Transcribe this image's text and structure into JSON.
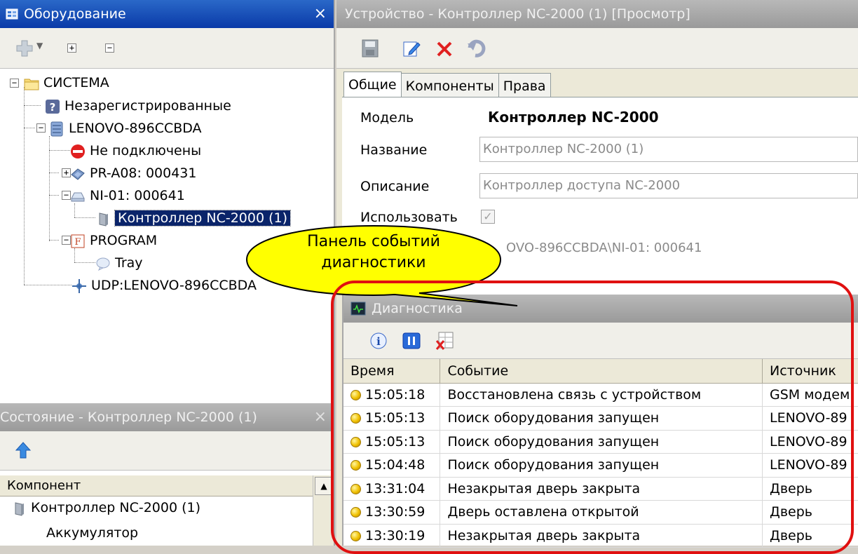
{
  "equipment_panel": {
    "title": "Оборудование",
    "close": "×",
    "tree": {
      "system": "СИСТЕМА",
      "unregistered": "Незарегистрированные",
      "host": "LENOVO-896CCBDA",
      "not_connected": "Не подключены",
      "pr_a08": "PR-A08: 000431",
      "ni_01": "NI-01: 000641",
      "controller": "Контроллер NC-2000 (1)",
      "program": "PROGRAM",
      "tray": "Tray",
      "udp": "UDP:LENOVO-896CCBDA"
    }
  },
  "state_panel": {
    "title": "Состояние - Контроллер NC-2000 (1)",
    "close": "×",
    "column_header": "Компонент",
    "rows": [
      "Контроллер NC-2000 (1)",
      "Аккумулятор"
    ]
  },
  "device_panel": {
    "title": "Устройство - Контроллер NC-2000 (1) [Просмотр]",
    "tabs": [
      "Общие",
      "Компоненты",
      "Права"
    ],
    "model_label": "Модель",
    "model_value": "Контроллер NC-2000",
    "name_label": "Название",
    "name_value": "Контроллер NC-2000 (1)",
    "desc_label": "Описание",
    "desc_value": "Контроллер доступа NC-2000",
    "use_label": "Использовать",
    "path_value": "OVO-896CCBDA\\NI-01: 000641"
  },
  "callout": {
    "line1": "Панель событий",
    "line2": "диагностики"
  },
  "diagnostics": {
    "title": "Диагностика",
    "columns": [
      "Время",
      "Событие",
      "Источник"
    ],
    "rows": [
      {
        "time": "15:05:18",
        "event": "Восстановлена связь с устройством",
        "source": "GSM модем"
      },
      {
        "time": "15:05:13",
        "event": "Поиск оборудования запущен",
        "source": "LENOVO-89"
      },
      {
        "time": "15:05:13",
        "event": "Поиск оборудования запущен",
        "source": "LENOVO-89"
      },
      {
        "time": "15:04:48",
        "event": "Поиск оборудования запущен",
        "source": "LENOVO-89"
      },
      {
        "time": "13:31:04",
        "event": "Незакрытая дверь закрыта",
        "source": "Дверь"
      },
      {
        "time": "13:30:59",
        "event": "Дверь оставлена открытой",
        "source": "Дверь"
      },
      {
        "time": "13:30:19",
        "event": "Незакрытая дверь закрыта",
        "source": "Дверь"
      }
    ]
  },
  "colors": {
    "active_title": "#0a3aa8",
    "selection": "#0a246a",
    "highlight_ring": "#e01010",
    "callout_fill": "#ffff00",
    "event_dot": "#f0c000"
  },
  "icons": [
    "equipment-icon",
    "add-icon",
    "expand-all-icon",
    "collapse-all-icon",
    "folder-icon",
    "question-icon",
    "server-icon",
    "stop-icon",
    "reader-icon",
    "drive-icon",
    "controller-icon",
    "program-icon",
    "tray-icon",
    "network-icon",
    "up-arrow-icon",
    "save-icon",
    "edit-icon",
    "delete-icon",
    "undo-icon",
    "diagnostics-icon",
    "info-icon",
    "pause-icon",
    "clear-icon"
  ]
}
